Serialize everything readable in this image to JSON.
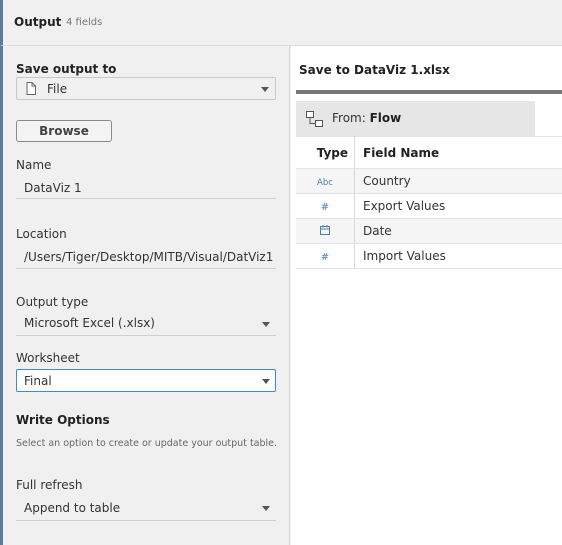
{
  "header": {
    "title": "Output",
    "subtitle": "4 fields"
  },
  "left": {
    "save_output_label": "Save output to",
    "save_output_value": "File",
    "browse_label": "Browse",
    "name_label": "Name",
    "name_value": "DataViz 1",
    "location_label": "Location",
    "location_value": "/Users/Tiger/Desktop/MITB/Visual/DatViz1",
    "output_type_label": "Output type",
    "output_type_value": "Microsoft Excel (.xlsx)",
    "worksheet_label": "Worksheet",
    "worksheet_value": "Final",
    "write_options_label": "Write Options",
    "write_options_help": "Select an option to create or update your output table.",
    "full_refresh_label": "Full refresh",
    "full_refresh_value": "Append to table"
  },
  "right": {
    "save_title": "Save to DataViz 1.xlsx",
    "from_prefix": "From:",
    "from_value": "Flow",
    "columns": {
      "type": "Type",
      "field_name": "Field Name"
    },
    "rows": [
      {
        "type_icon": "Abc",
        "icon_name": "string-type-icon",
        "name": "Country"
      },
      {
        "type_icon": "#",
        "icon_name": "number-type-icon",
        "name": "Export Values"
      },
      {
        "type_icon": "📅",
        "icon_name": "date-type-icon",
        "name": "Date"
      },
      {
        "type_icon": "#",
        "icon_name": "number-type-icon",
        "name": "Import Values"
      }
    ]
  },
  "colors": {
    "accent": "#5a7f9e",
    "focus": "#3d8bd6",
    "type_icon": "#4a7fb0"
  }
}
